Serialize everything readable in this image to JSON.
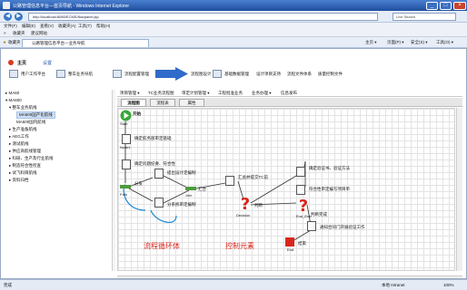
{
  "window": {
    "title": "公路管理信息平台—首页导航 - Windows Internet Explorer",
    "btn_min": "_",
    "btn_max": "□",
    "btn_close": "×"
  },
  "addressbar": {
    "url": "http://localhost:8080/ECMS/flowpanel.jsp",
    "search_placeholder": "Live Search",
    "nav_back": "◀",
    "nav_fwd": "▶"
  },
  "menubar": {
    "items": [
      "文件(F)",
      "编辑(E)",
      "查看(V)",
      "收藏夹(A)",
      "工具(T)",
      "帮助(H)"
    ]
  },
  "linkbar": {
    "items": [
      "×",
      "收藏夹",
      "建议网站"
    ]
  },
  "favbar": {
    "fav_label": "收藏夹",
    "tab_label": "公路管理信息平台—业务导航",
    "tools": [
      "主页 ▾",
      "页面(P) ▾",
      "安全(S) ▾",
      "工具(O) ▾"
    ]
  },
  "sysbar": {
    "home": "主页",
    "settings": "设置",
    "modules": [
      "用户工作平台",
      "整车业务导航",
      "流程配置管理",
      "流程图设计",
      "基础数据管理",
      "设计项目支持",
      "流程文件体系",
      "质量控制文件"
    ]
  },
  "sidebar": {
    "items": [
      {
        "label": "▸ MA60",
        "level": 0,
        "selected": false
      },
      {
        "label": "▾ MA600",
        "level": 0,
        "selected": false
      },
      {
        "label": "▾ 整车业务航线",
        "level": 1,
        "selected": false
      },
      {
        "label": "MA600国产化航线",
        "level": 2,
        "selected": true
      },
      {
        "label": "MA600国内航线",
        "level": 2,
        "selected": false
      },
      {
        "label": "▸ 生产准备航线",
        "level": 1,
        "selected": false
      },
      {
        "label": "▸ AEG工作",
        "level": 1,
        "selected": false
      },
      {
        "label": "▸ 测试航线",
        "level": 1,
        "selected": false
      },
      {
        "label": "▸ 供应商航线管理",
        "level": 1,
        "selected": false
      },
      {
        "label": "▸ 科研、生产及行业航线",
        "level": 1,
        "selected": false
      },
      {
        "label": "▸ 制造符合性检查",
        "level": 1,
        "selected": false
      },
      {
        "label": "▸ 试飞科目航线",
        "level": 1,
        "selected": false
      },
      {
        "label": "▸ 资料归档",
        "level": 1,
        "selected": false
      }
    ]
  },
  "main": {
    "topmenu": [
      "项目管理 ▾",
      "TC业务流程图",
      "审定计划管理 ▾",
      "工程批准业务",
      "业务办理 ▾",
      "信息发布"
    ],
    "tabs": [
      "流程图",
      "流程表",
      "属性"
    ],
    "active_tab": "流程图"
  },
  "flow": {
    "start": "开始",
    "start_en": "Start",
    "step1": "确定航务部审定基础",
    "step2": "确定问题纪要、符合性",
    "fork": "分支",
    "fork_en": "Fork",
    "step_design": "提出设计定编制",
    "step_join_lbl": "汇合",
    "join_en": "Join",
    "step_sub": "分系统审定编制",
    "step_tc": "汇总并提交TC前",
    "decision_lbl": "判断",
    "decision_en": "Decision",
    "step_verify": "确定验证书、验证方法",
    "step_compliance": "符合性审定编写项目单",
    "endlbl": "判断完成",
    "endlbl_en": "End_End",
    "step_notify": "通知合同门开展验证工作",
    "end": "结束",
    "end_en": "End",
    "anno_loop": "流程循环体",
    "anno_ctrl": "控制元素",
    "node": "Node1"
  },
  "statusbar": {
    "left": "完成",
    "right": "本地 Intranet",
    "zoom": "100%"
  }
}
